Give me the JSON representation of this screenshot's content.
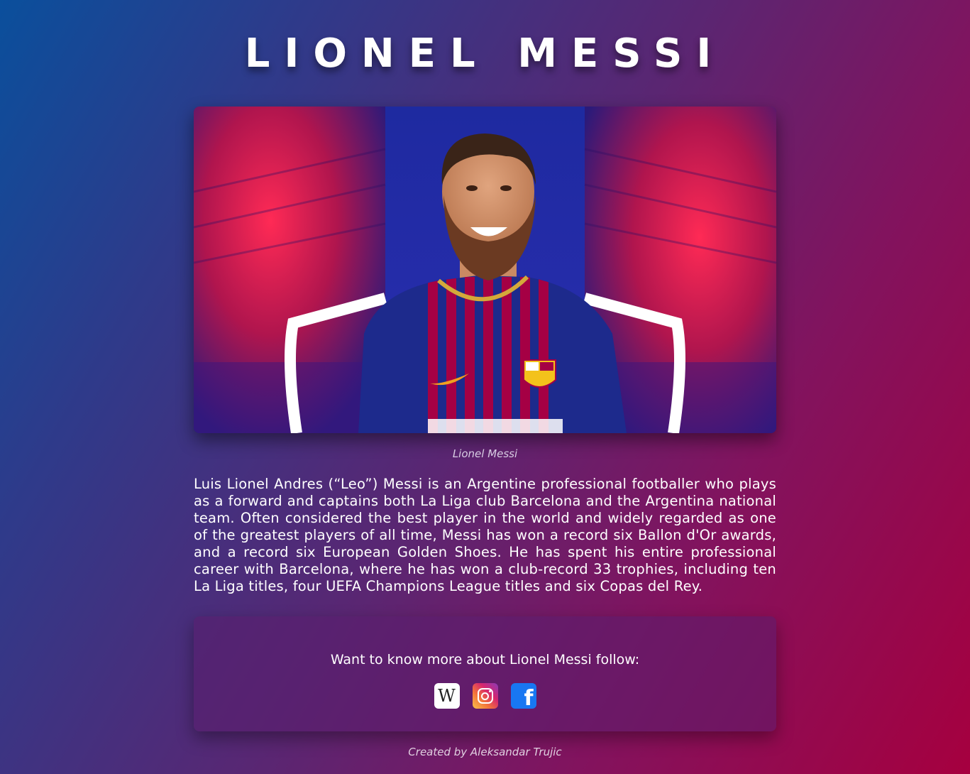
{
  "page": {
    "title": "LIONEL MESSI"
  },
  "hero": {
    "image_alt": "Lionel Messi in Barcelona jersey",
    "caption": "Lionel Messi"
  },
  "bio": {
    "text": "Luis Lionel Andres (“Leo”) Messi is an Argentine professional footballer who plays as a forward and captains both La Liga club Barcelona and the Argentina national team. Often considered the best player in the world and widely regarded as one of the greatest players of all time, Messi has won a record six Ballon d'Or awards, and a record six European Golden Shoes. He has spent his entire professional career with Barcelona, where he has won a club-record 33 trophies, including ten La Liga titles, four UEFA Champions League titles and six Copas del Rey."
  },
  "follow": {
    "text": "Want to know more about Lionel Messi follow:",
    "links": [
      {
        "name": "Wikipedia",
        "icon": "wikipedia-icon",
        "glyph": "W"
      },
      {
        "name": "Instagram",
        "icon": "instagram-icon"
      },
      {
        "name": "Facebook",
        "icon": "facebook-icon",
        "glyph": "f"
      }
    ]
  },
  "footer": {
    "credit": "Created by Aleksandar Trujic"
  },
  "colors": {
    "gradient_start": "#0a4f9c",
    "gradient_end": "#a6003f",
    "jersey_blue": "#1d2a8c",
    "jersey_red": "#a50044",
    "facebook_blue": "#1877f2"
  }
}
